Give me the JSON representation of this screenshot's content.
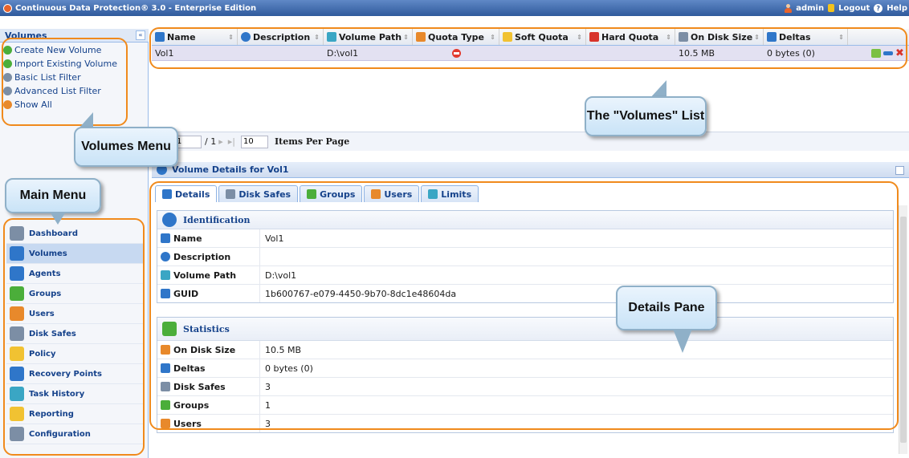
{
  "app": {
    "title": "Continuous Data Protection® 3.0 - Enterprise Edition",
    "user": "admin",
    "logout": "Logout",
    "help": "Help"
  },
  "volumes_menu": {
    "title": "Volumes",
    "collapse_glyph": "«",
    "items": [
      {
        "label": "Create New Volume",
        "icon": "add-icon"
      },
      {
        "label": "Import Existing Volume",
        "icon": "import-icon"
      },
      {
        "label": "Basic List Filter",
        "icon": "filter-icon"
      },
      {
        "label": "Advanced List Filter",
        "icon": "advanced-filter-icon"
      },
      {
        "label": "Show All",
        "icon": "show-all-icon"
      }
    ]
  },
  "main_menu": {
    "items": [
      {
        "label": "Dashboard",
        "icon": "dashboard-icon"
      },
      {
        "label": "Volumes",
        "icon": "volumes-icon",
        "active": true
      },
      {
        "label": "Agents",
        "icon": "agents-icon"
      },
      {
        "label": "Groups",
        "icon": "groups-icon"
      },
      {
        "label": "Users",
        "icon": "users-icon"
      },
      {
        "label": "Disk Safes",
        "icon": "disk-safes-icon"
      },
      {
        "label": "Policy",
        "icon": "policy-icon"
      },
      {
        "label": "Recovery Points",
        "icon": "recovery-points-icon"
      },
      {
        "label": "Task History",
        "icon": "task-history-icon"
      },
      {
        "label": "Reporting",
        "icon": "reporting-icon"
      },
      {
        "label": "Configuration",
        "icon": "configuration-icon"
      }
    ]
  },
  "volumes_grid": {
    "columns": [
      "Name",
      "Description",
      "Volume Path",
      "Quota Type",
      "Soft Quota",
      "Hard Quota",
      "On Disk Size",
      "Deltas"
    ],
    "rows": [
      {
        "name": "Vol1",
        "description": "",
        "volume_path": "D:\\vol1",
        "quota_type": "none",
        "soft_quota": "",
        "hard_quota": "",
        "on_disk_size": "10.5 MB",
        "deltas": "0 bytes (0)"
      }
    ]
  },
  "pager": {
    "page": "1",
    "of_pages": "/ 1",
    "per_page": "10",
    "items_per_page_label": "Items Per Page"
  },
  "details": {
    "title": "Volume Details for Vol1",
    "tabs": [
      "Details",
      "Disk Safes",
      "Groups",
      "Users",
      "Limits"
    ],
    "identification": {
      "title": "Identification",
      "rows": [
        {
          "key": "Name",
          "value": "Vol1"
        },
        {
          "key": "Description",
          "value": ""
        },
        {
          "key": "Volume Path",
          "value": "D:\\vol1"
        },
        {
          "key": "GUID",
          "value": "1b600767-e079-4450-9b70-8dc1e48604da"
        }
      ]
    },
    "statistics": {
      "title": "Statistics",
      "rows": [
        {
          "key": "On Disk Size",
          "value": "10.5 MB"
        },
        {
          "key": "Deltas",
          "value": "0 bytes (0)"
        },
        {
          "key": "Disk Safes",
          "value": "3"
        },
        {
          "key": "Groups",
          "value": "1"
        },
        {
          "key": "Users",
          "value": "3"
        }
      ]
    }
  },
  "annotations": {
    "volumes_list": "The \"Volumes\" List",
    "volumes_menu": "Volumes Menu",
    "main_menu": "Main Menu",
    "details_pane": "Details Pane"
  },
  "colors": {
    "outline": "#f08a1c",
    "header": "#2f5a9c",
    "selected_row": "#e3e1f2"
  }
}
